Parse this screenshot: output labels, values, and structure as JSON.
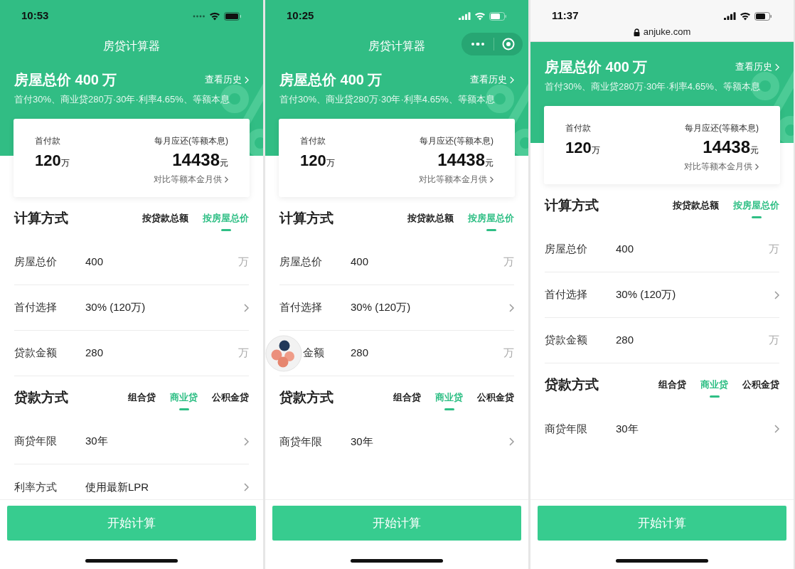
{
  "phones": [
    {
      "status_bar": {
        "time": "10:53",
        "kind": "dots"
      },
      "header": {
        "kind": "title",
        "title": "房贷计算器"
      },
      "summary": {
        "title": "房屋总价 400 万",
        "history": "查看历史",
        "detail": "首付30%、商业贷280万·30年·利率4.65%、等额本息"
      },
      "card": {
        "down_label": "首付款",
        "down_value": "120",
        "down_unit": "万",
        "monthly_label": "每月应还(等额本息)",
        "monthly_value": "14438",
        "monthly_unit": "元",
        "compare": "对比等额本金月供"
      },
      "sections": [
        {
          "title": "计算方式",
          "tabs": [
            {
              "label": "按贷款总额",
              "selected": false
            },
            {
              "label": "按房屋总价",
              "selected": true
            }
          ],
          "rows": [
            {
              "label": "房屋总价",
              "value": "400",
              "kind": "unit",
              "unit": "万"
            },
            {
              "label": "首付选择",
              "value": "30% (120万)",
              "kind": "select"
            },
            {
              "label": "贷款金额",
              "value": "280",
              "kind": "unit",
              "unit": "万"
            }
          ]
        },
        {
          "title": "贷款方式",
          "tabs": [
            {
              "label": "组合贷",
              "selected": false
            },
            {
              "label": "商业贷",
              "selected": true
            },
            {
              "label": "公积金贷",
              "selected": false
            }
          ],
          "rows": [
            {
              "label": "商贷年限",
              "value": "30年",
              "kind": "select"
            },
            {
              "label": "利率方式",
              "value": "使用最新LPR",
              "kind": "select"
            }
          ]
        }
      ],
      "button": "开始计算"
    },
    {
      "status_bar": {
        "time": "10:25",
        "kind": "bars"
      },
      "header": {
        "kind": "miniapp",
        "title": "房贷计算器"
      },
      "summary": {
        "title": "房屋总价 400 万",
        "history": "查看历史",
        "detail": "首付30%、商业贷280万·30年·利率4.65%、等额本息"
      },
      "card": {
        "down_label": "首付款",
        "down_value": "120",
        "down_unit": "万",
        "monthly_label": "每月应还(等额本息)",
        "monthly_value": "14438",
        "monthly_unit": "元",
        "compare": "对比等额本金月供"
      },
      "sections": [
        {
          "title": "计算方式",
          "tabs": [
            {
              "label": "按贷款总额",
              "selected": false
            },
            {
              "label": "按房屋总价",
              "selected": true
            }
          ],
          "rows": [
            {
              "label": "房屋总价",
              "value": "400",
              "kind": "unit",
              "unit": "万"
            },
            {
              "label": "首付选择",
              "value": "30% (120万)",
              "kind": "select"
            },
            {
              "label": "金额",
              "value": "280",
              "kind": "unit",
              "unit": "万",
              "float_ball": true
            }
          ]
        },
        {
          "title": "贷款方式",
          "tabs": [
            {
              "label": "组合贷",
              "selected": false
            },
            {
              "label": "商业贷",
              "selected": true
            },
            {
              "label": "公积金贷",
              "selected": false
            }
          ],
          "rows": [
            {
              "label": "商贷年限",
              "value": "30年",
              "kind": "select"
            }
          ]
        }
      ],
      "button": "开始计算"
    },
    {
      "status_bar": {
        "time": "11:37",
        "kind": "bars"
      },
      "header": {
        "kind": "browser",
        "url": "anjuke.com"
      },
      "summary": {
        "title": "房屋总价 400 万",
        "history": "查看历史",
        "detail": "首付30%、商业贷280万·30年·利率4.65%、等额本息"
      },
      "card": {
        "down_label": "首付款",
        "down_value": "120",
        "down_unit": "万",
        "monthly_label": "每月应还(等额本息)",
        "monthly_value": "14438",
        "monthly_unit": "元",
        "compare": "对比等额本金月供"
      },
      "sections": [
        {
          "title": "计算方式",
          "tabs": [
            {
              "label": "按贷款总额",
              "selected": false
            },
            {
              "label": "按房屋总价",
              "selected": true
            }
          ],
          "rows": [
            {
              "label": "房屋总价",
              "value": "400",
              "kind": "unit",
              "unit": "万"
            },
            {
              "label": "首付选择",
              "value": "30% (120万)",
              "kind": "select"
            },
            {
              "label": "贷款金额",
              "value": "280",
              "kind": "unit",
              "unit": "万"
            }
          ]
        },
        {
          "title": "贷款方式",
          "tabs": [
            {
              "label": "组合贷",
              "selected": false
            },
            {
              "label": "商业贷",
              "selected": true
            },
            {
              "label": "公积金贷",
              "selected": false
            }
          ],
          "rows": [
            {
              "label": "商贷年限",
              "value": "30年",
              "kind": "select"
            }
          ]
        }
      ],
      "button": "开始计算"
    }
  ]
}
